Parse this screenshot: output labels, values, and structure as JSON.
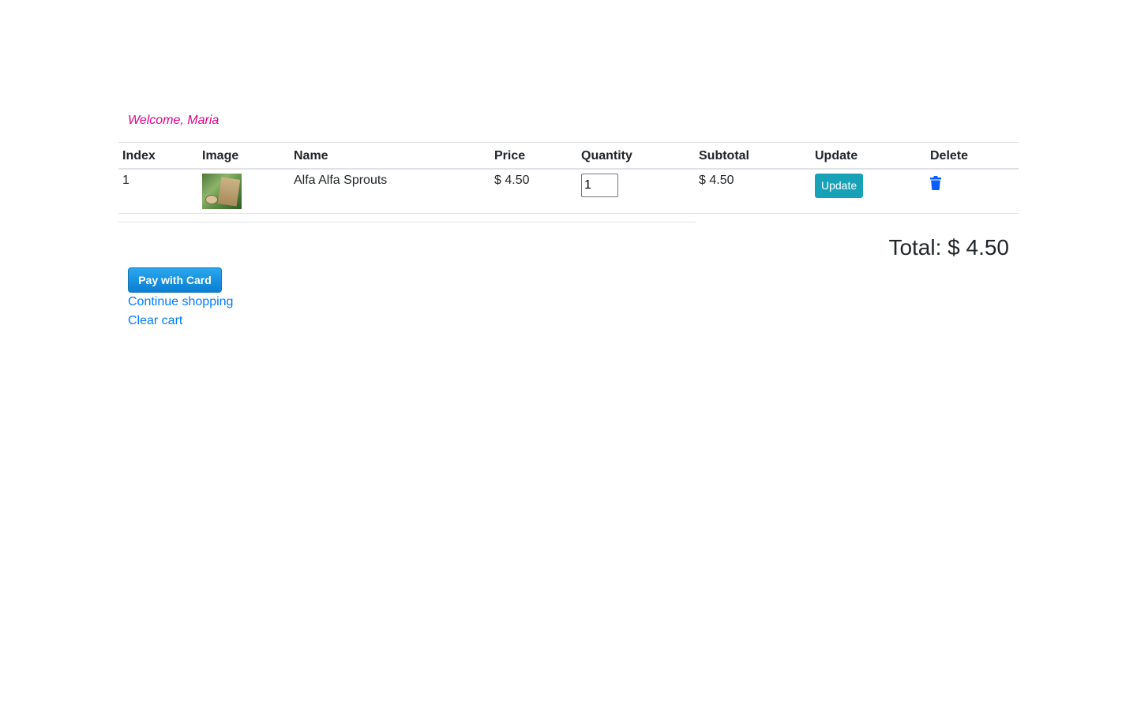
{
  "colors": {
    "welcome": "#e6008a",
    "link": "#007bff",
    "update_button": "#17a2b8",
    "delete_icon": "#0a5cff",
    "pay_button": "#1a94e0"
  },
  "header": {
    "welcome_text": "Welcome, Maria"
  },
  "cart": {
    "columns": [
      "Index",
      "Image",
      "Name",
      "Price",
      "Quantity",
      "Subtotal",
      "Update",
      "Delete"
    ],
    "rows": [
      {
        "index": "1",
        "image_icon": "alfa-alfa-sprouts-product-image",
        "name": "Alfa Alfa Sprouts",
        "price": "$ 4.50",
        "quantity": "1",
        "subtotal": "$ 4.50",
        "update_label": "Update",
        "delete_icon": "trash-icon"
      }
    ]
  },
  "summary": {
    "total_text": "Total: $ 4.50"
  },
  "actions": {
    "pay_label": "Pay with Card",
    "continue_label": "Continue shopping",
    "clear_label": "Clear cart"
  }
}
